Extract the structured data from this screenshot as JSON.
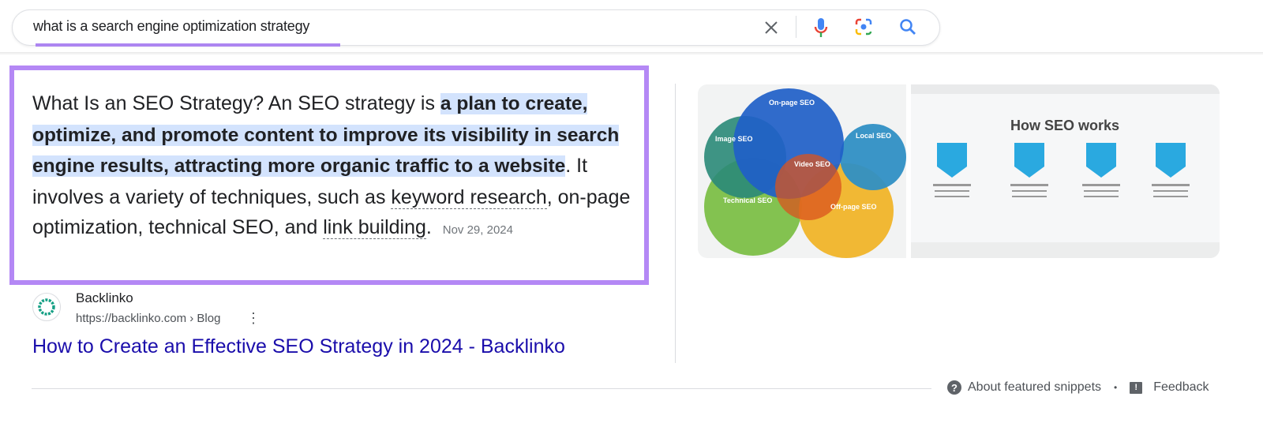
{
  "search": {
    "query": "what is a search engine optimization strategy",
    "icons": [
      "close-icon",
      "mic-icon",
      "lens-icon",
      "search-icon"
    ]
  },
  "snippet": {
    "intro": "What Is an SEO Strategy? An SEO strategy is ",
    "highlight": "a plan to create, optimize, and promote content to improve its visibility in search engine results, attracting more organic traffic to a website",
    "middle": ". It involves a variety of techniques, such as ",
    "term1": "keyword research",
    "middle2": ", on-page optimization, technical SEO, and ",
    "term2": "link building",
    "end": ".",
    "date": "Nov 29, 2024"
  },
  "source": {
    "site_name": "Backlinko",
    "url": "https://backlinko.com › Blog",
    "title": "How to Create an Effective SEO Strategy in 2024 - Backlinko"
  },
  "images": {
    "venn_labels": [
      "On-page SEO",
      "Image SEO",
      "Local SEO",
      "Video SEO",
      "Technical SEO",
      "Off-page SEO"
    ],
    "how_title": "How SEO works"
  },
  "footer": {
    "about": "About featured snippets",
    "separator": "•",
    "feedback": "Feedback"
  },
  "colors": {
    "highlight": "#d3e3fd",
    "annotation": "#b488f5",
    "link": "#1a0dab"
  }
}
